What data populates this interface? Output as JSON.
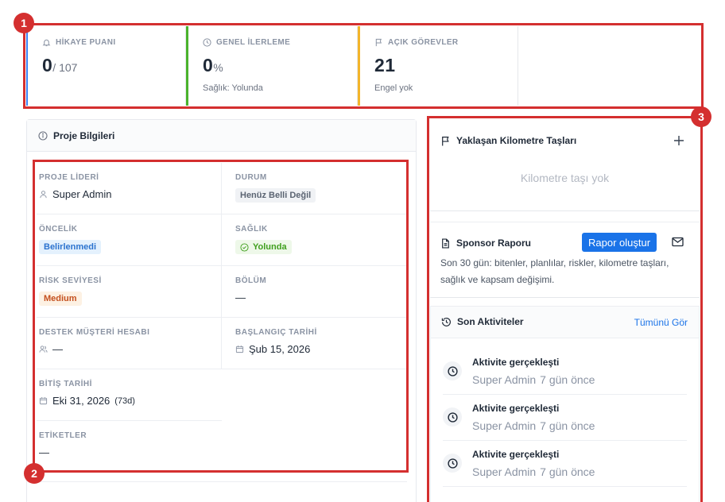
{
  "stats": [
    {
      "label": "HİKAYE PUANI",
      "value": "0",
      "sub": "/ 107",
      "note": "",
      "icon": "bell-icon",
      "accent": "#3b82f6"
    },
    {
      "label": "GENEL İLERLEME",
      "value": "0",
      "sub": "%",
      "note": "Sağlık: Yolunda",
      "icon": "clock-icon",
      "accent": "#4ab32c"
    },
    {
      "label": "AÇIK GÖREVLER",
      "value": "21",
      "sub": "",
      "note": "Engel yok",
      "icon": "flag-icon",
      "accent": "#f3b52b"
    }
  ],
  "project_info": {
    "title": "Proje Bilgileri",
    "fields": {
      "leader": {
        "label": "PROJE LİDERİ",
        "value": "Super Admin"
      },
      "status": {
        "label": "DURUM",
        "value": "Henüz Belli Değil"
      },
      "priority": {
        "label": "ÖNCELİK",
        "value": "Belirlenmedi"
      },
      "health": {
        "label": "SAĞLIK",
        "value": "Yolunda"
      },
      "risk": {
        "label": "RİSK SEVİYESİ",
        "value": "Medium"
      },
      "department": {
        "label": "BÖLÜM",
        "value": "—"
      },
      "support_account": {
        "label": "DESTEK MÜŞTERİ HESABI",
        "value": "—"
      },
      "start_date": {
        "label": "BAŞLANGIÇ TARİHİ",
        "value": "Şub 15, 2026"
      },
      "end_date": {
        "label": "BİTİŞ TARİHİ",
        "value": "Eki 31, 2026",
        "extra": "(73d)"
      },
      "tags": {
        "label": "ETİKETLER",
        "value": "—"
      }
    }
  },
  "milestones": {
    "title": "Yaklaşan Kilometre Taşları",
    "empty": "Kilometre taşı yok"
  },
  "sponsor": {
    "title": "Sponsor Raporu",
    "button": "Rapor oluştur",
    "description": "Son 30 gün: bitenler, planlılar, riskler, kilometre taşları, sağlık ve kapsam değişimi."
  },
  "activity": {
    "title": "Son Aktiviteler",
    "link": "Tümünü Gör",
    "items": [
      {
        "title": "Aktivite gerçekleşti",
        "user": "Super Admin",
        "time": "7 gün önce"
      },
      {
        "title": "Aktivite gerçekleşti",
        "user": "Super Admin",
        "time": "7 gün önce"
      },
      {
        "title": "Aktivite gerçekleşti",
        "user": "Super Admin",
        "time": "7 gün önce"
      }
    ]
  },
  "annotations": [
    "1",
    "2",
    "3"
  ],
  "colors": {
    "primary": "#1a73e8",
    "annotation": "#d42f2f"
  }
}
